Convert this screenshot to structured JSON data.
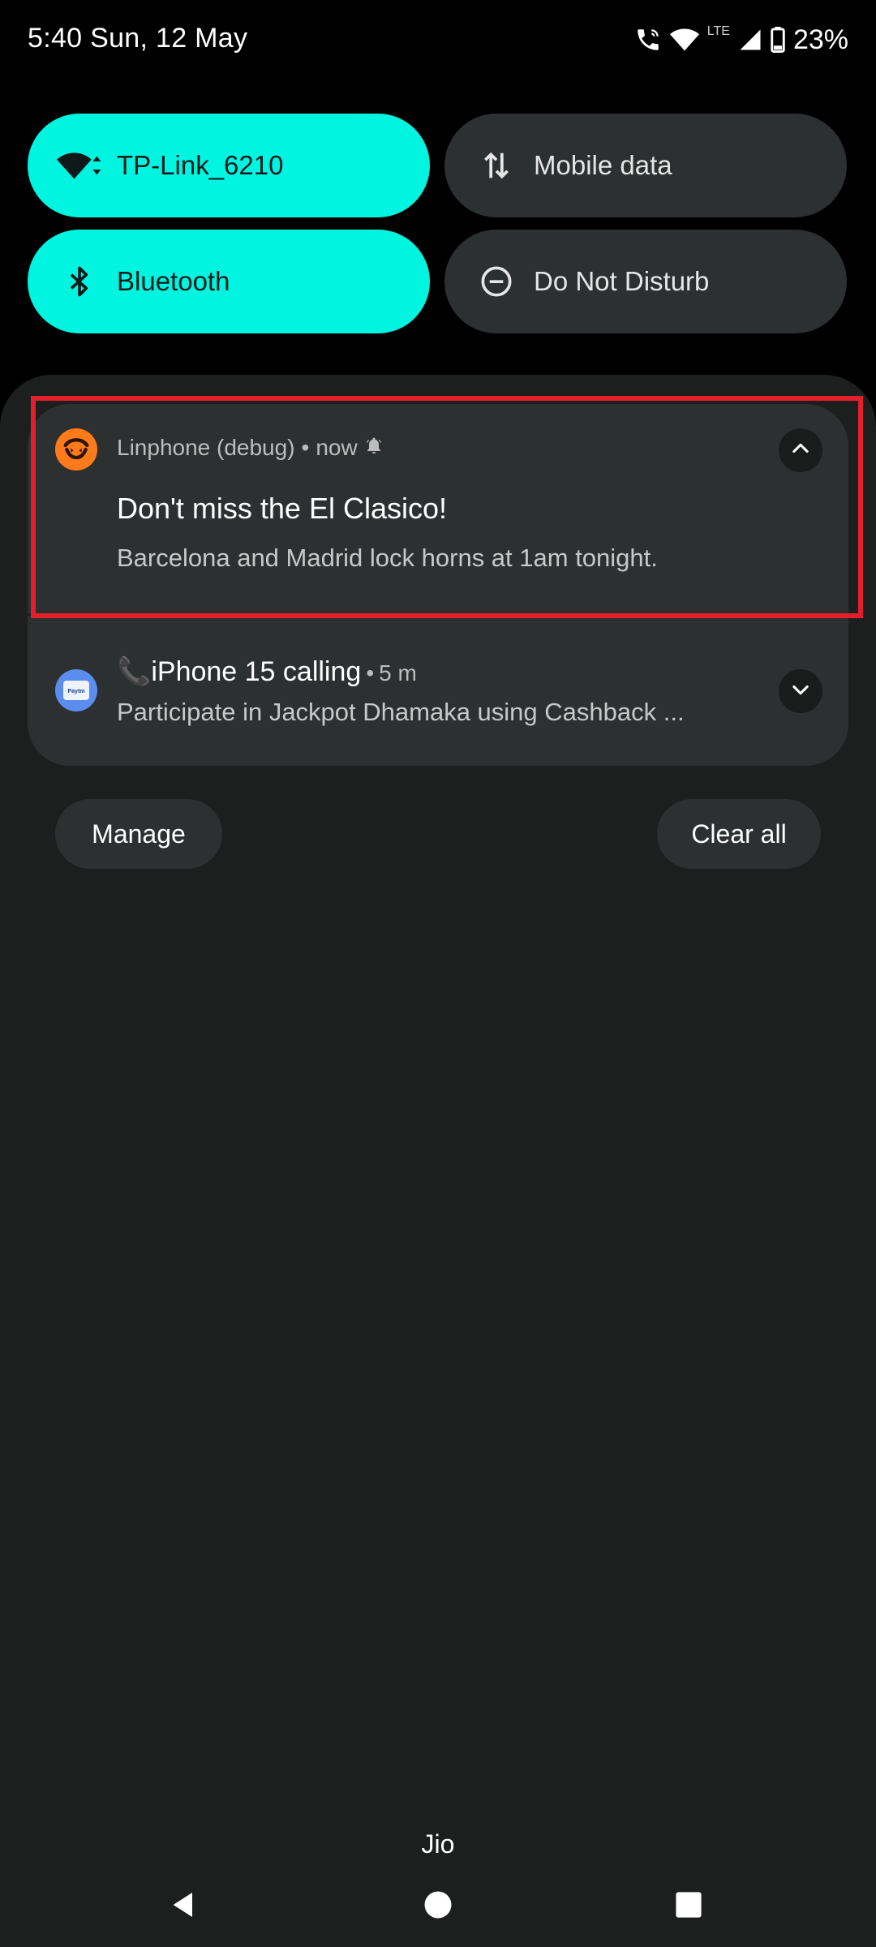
{
  "status_bar": {
    "time_date": "5:40 Sun, 12 May",
    "network_type": "LTE",
    "battery": "23%"
  },
  "quick_settings": {
    "tiles": [
      {
        "label": "TP-Link_6210",
        "icon": "wifi-icon",
        "state": "on"
      },
      {
        "label": "Mobile data",
        "icon": "data-arrows-icon",
        "state": "off"
      },
      {
        "label": "Bluetooth",
        "icon": "bluetooth-icon",
        "state": "on"
      },
      {
        "label": "Do Not Disturb",
        "icon": "dnd-icon",
        "state": "off"
      }
    ]
  },
  "notifications": [
    {
      "app": "Linphone (debug)",
      "separator": "•",
      "time": "now",
      "title": "Don't miss the El Clasico!",
      "body": "Barcelona and Madrid lock horns at 1am tonight.",
      "icon": "linphone-icon",
      "expanded": true
    },
    {
      "title": "📞iPhone 15 calling",
      "separator": "•",
      "time": "5 m",
      "body": "Participate in Jackpot Dhamaka using Cashback ...",
      "icon": "paytm-icon",
      "icon_text": "Paytm",
      "expanded": false
    }
  ],
  "actions": {
    "manage": "Manage",
    "clear_all": "Clear all"
  },
  "carrier": "Jio",
  "colors": {
    "tile_on": "#00F5E1",
    "tile_off": "#2d3030",
    "shade": "#1d1f1f",
    "highlight": "#e3202a",
    "linphone": "#ff7a1a",
    "paytm": "#5b8def"
  }
}
